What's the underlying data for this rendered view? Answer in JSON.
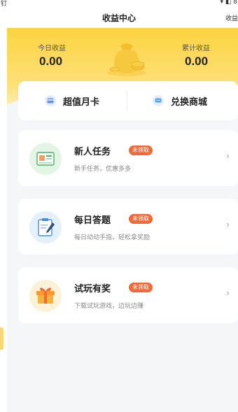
{
  "status_bar": {
    "left": "钉",
    "right": "▾ ◧ 8"
  },
  "header": {
    "title": "收益中心",
    "right_action": "收益"
  },
  "earnings": {
    "today_label": "今日收益",
    "today_value": "0.00",
    "total_label": "累计收益",
    "total_value": "0.00"
  },
  "tabs": [
    {
      "label": "超值月卡",
      "icon": "card-icon"
    },
    {
      "label": "兑换商城",
      "icon": "chat-shop-icon"
    }
  ],
  "tasks": [
    {
      "title": "新人任务",
      "badge": "未领取",
      "desc": "新手任务，优惠多多",
      "icon": "id-card-icon"
    },
    {
      "title": "每日答题",
      "badge": "未领取",
      "desc": "每日动动手指，轻松拿奖励",
      "icon": "clipboard-pen-icon"
    },
    {
      "title": "试玩有奖",
      "badge": "未领取",
      "desc": "下载试玩游戏，边玩边赚",
      "icon": "gift-icon"
    }
  ],
  "colors": {
    "banner_yellow": "#fcd33f",
    "badge_orange": "#ef6a3a",
    "background": "#f5f6f8"
  }
}
